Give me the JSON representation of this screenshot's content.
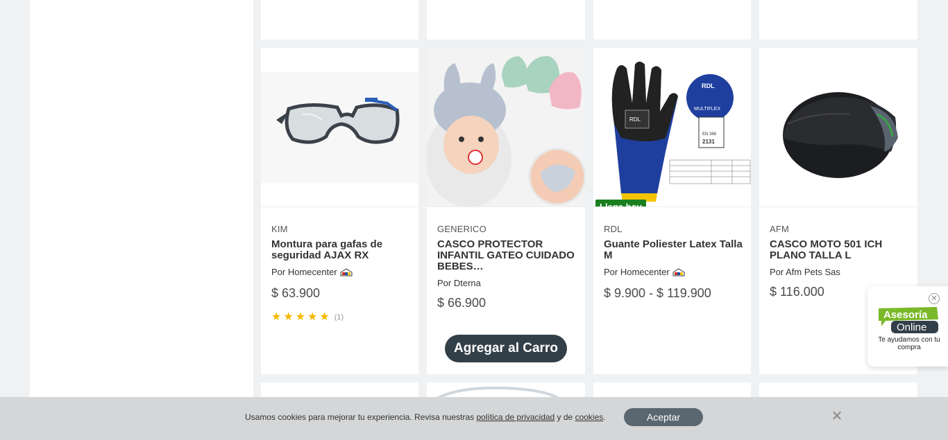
{
  "products": [
    {
      "brand": "KIM",
      "title": "Montura para gafas de seguridad AJAX RX",
      "seller": "Por Homecenter",
      "price": "$ 63.900",
      "rating_count": "(1)"
    },
    {
      "brand": "GENERICO",
      "title": "CASCO PROTECTOR INFANTIL GATEO CUIDADO BEBES…",
      "seller": "Por Dterna",
      "price": "$ 66.900",
      "add_to_cart": "Agregar al Carro"
    },
    {
      "brand": "RDL",
      "title": "Guante Poliester Latex Talla M",
      "seller": "Por Homecenter",
      "price": "$ 9.900 - $ 119.900",
      "badge": "Llega hoy",
      "image_text": {
        "logo": "RDL",
        "model": "MULTIFLEX",
        "standard": "EN 388",
        "code": "2131"
      }
    },
    {
      "brand": "AFM",
      "title": "CASCO MOTO 501 ICH PLANO TALLA L",
      "seller": "Por Afm Pets Sas",
      "price": "$ 116.000"
    }
  ],
  "rating": {
    "stars": 5
  },
  "chat": {
    "brand_line1": "Asesoría",
    "brand_line2": "Online",
    "tagline": "Te ayudamos con tu compra"
  },
  "cookie": {
    "text_before": "Usamos cookies para mejorar tu experiencia. Revisa nuestras ",
    "privacy_link": "política de privacidad",
    "text_middle": " y de ",
    "cookies_link": "cookies",
    "text_after": ".",
    "accept_label": "Aceptar"
  },
  "colors": {
    "badge_green": "#1a7f1e",
    "star_yellow": "#f5b800",
    "button_dark": "#333f48",
    "chat_green": "#7ab929"
  }
}
